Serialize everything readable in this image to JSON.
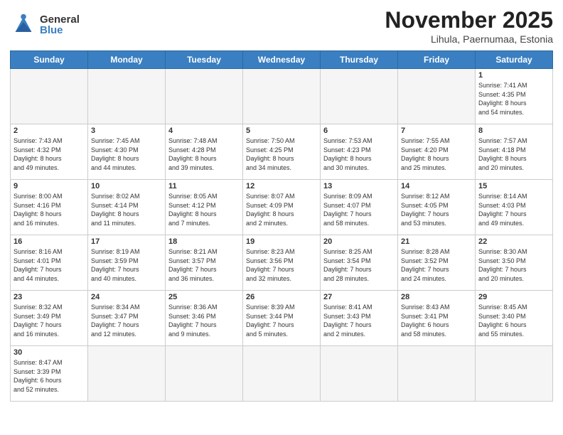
{
  "logo": {
    "general": "General",
    "blue": "Blue"
  },
  "header": {
    "month": "November 2025",
    "location": "Lihula, Paernumaa, Estonia"
  },
  "weekdays": [
    "Sunday",
    "Monday",
    "Tuesday",
    "Wednesday",
    "Thursday",
    "Friday",
    "Saturday"
  ],
  "days": [
    {
      "num": "",
      "info": ""
    },
    {
      "num": "",
      "info": ""
    },
    {
      "num": "",
      "info": ""
    },
    {
      "num": "",
      "info": ""
    },
    {
      "num": "",
      "info": ""
    },
    {
      "num": "",
      "info": ""
    },
    {
      "num": "1",
      "info": "Sunrise: 7:41 AM\nSunset: 4:35 PM\nDaylight: 8 hours\nand 54 minutes."
    },
    {
      "num": "2",
      "info": "Sunrise: 7:43 AM\nSunset: 4:32 PM\nDaylight: 8 hours\nand 49 minutes."
    },
    {
      "num": "3",
      "info": "Sunrise: 7:45 AM\nSunset: 4:30 PM\nDaylight: 8 hours\nand 44 minutes."
    },
    {
      "num": "4",
      "info": "Sunrise: 7:48 AM\nSunset: 4:28 PM\nDaylight: 8 hours\nand 39 minutes."
    },
    {
      "num": "5",
      "info": "Sunrise: 7:50 AM\nSunset: 4:25 PM\nDaylight: 8 hours\nand 34 minutes."
    },
    {
      "num": "6",
      "info": "Sunrise: 7:53 AM\nSunset: 4:23 PM\nDaylight: 8 hours\nand 30 minutes."
    },
    {
      "num": "7",
      "info": "Sunrise: 7:55 AM\nSunset: 4:20 PM\nDaylight: 8 hours\nand 25 minutes."
    },
    {
      "num": "8",
      "info": "Sunrise: 7:57 AM\nSunset: 4:18 PM\nDaylight: 8 hours\nand 20 minutes."
    },
    {
      "num": "9",
      "info": "Sunrise: 8:00 AM\nSunset: 4:16 PM\nDaylight: 8 hours\nand 16 minutes."
    },
    {
      "num": "10",
      "info": "Sunrise: 8:02 AM\nSunset: 4:14 PM\nDaylight: 8 hours\nand 11 minutes."
    },
    {
      "num": "11",
      "info": "Sunrise: 8:05 AM\nSunset: 4:12 PM\nDaylight: 8 hours\nand 7 minutes."
    },
    {
      "num": "12",
      "info": "Sunrise: 8:07 AM\nSunset: 4:09 PM\nDaylight: 8 hours\nand 2 minutes."
    },
    {
      "num": "13",
      "info": "Sunrise: 8:09 AM\nSunset: 4:07 PM\nDaylight: 7 hours\nand 58 minutes."
    },
    {
      "num": "14",
      "info": "Sunrise: 8:12 AM\nSunset: 4:05 PM\nDaylight: 7 hours\nand 53 minutes."
    },
    {
      "num": "15",
      "info": "Sunrise: 8:14 AM\nSunset: 4:03 PM\nDaylight: 7 hours\nand 49 minutes."
    },
    {
      "num": "16",
      "info": "Sunrise: 8:16 AM\nSunset: 4:01 PM\nDaylight: 7 hours\nand 44 minutes."
    },
    {
      "num": "17",
      "info": "Sunrise: 8:19 AM\nSunset: 3:59 PM\nDaylight: 7 hours\nand 40 minutes."
    },
    {
      "num": "18",
      "info": "Sunrise: 8:21 AM\nSunset: 3:57 PM\nDaylight: 7 hours\nand 36 minutes."
    },
    {
      "num": "19",
      "info": "Sunrise: 8:23 AM\nSunset: 3:56 PM\nDaylight: 7 hours\nand 32 minutes."
    },
    {
      "num": "20",
      "info": "Sunrise: 8:25 AM\nSunset: 3:54 PM\nDaylight: 7 hours\nand 28 minutes."
    },
    {
      "num": "21",
      "info": "Sunrise: 8:28 AM\nSunset: 3:52 PM\nDaylight: 7 hours\nand 24 minutes."
    },
    {
      "num": "22",
      "info": "Sunrise: 8:30 AM\nSunset: 3:50 PM\nDaylight: 7 hours\nand 20 minutes."
    },
    {
      "num": "23",
      "info": "Sunrise: 8:32 AM\nSunset: 3:49 PM\nDaylight: 7 hours\nand 16 minutes."
    },
    {
      "num": "24",
      "info": "Sunrise: 8:34 AM\nSunset: 3:47 PM\nDaylight: 7 hours\nand 12 minutes."
    },
    {
      "num": "25",
      "info": "Sunrise: 8:36 AM\nSunset: 3:46 PM\nDaylight: 7 hours\nand 9 minutes."
    },
    {
      "num": "26",
      "info": "Sunrise: 8:39 AM\nSunset: 3:44 PM\nDaylight: 7 hours\nand 5 minutes."
    },
    {
      "num": "27",
      "info": "Sunrise: 8:41 AM\nSunset: 3:43 PM\nDaylight: 7 hours\nand 2 minutes."
    },
    {
      "num": "28",
      "info": "Sunrise: 8:43 AM\nSunset: 3:41 PM\nDaylight: 6 hours\nand 58 minutes."
    },
    {
      "num": "29",
      "info": "Sunrise: 8:45 AM\nSunset: 3:40 PM\nDaylight: 6 hours\nand 55 minutes."
    },
    {
      "num": "30",
      "info": "Sunrise: 8:47 AM\nSunset: 3:39 PM\nDaylight: 6 hours\nand 52 minutes."
    },
    {
      "num": "",
      "info": ""
    },
    {
      "num": "",
      "info": ""
    },
    {
      "num": "",
      "info": ""
    },
    {
      "num": "",
      "info": ""
    },
    {
      "num": "",
      "info": ""
    },
    {
      "num": "",
      "info": ""
    }
  ]
}
